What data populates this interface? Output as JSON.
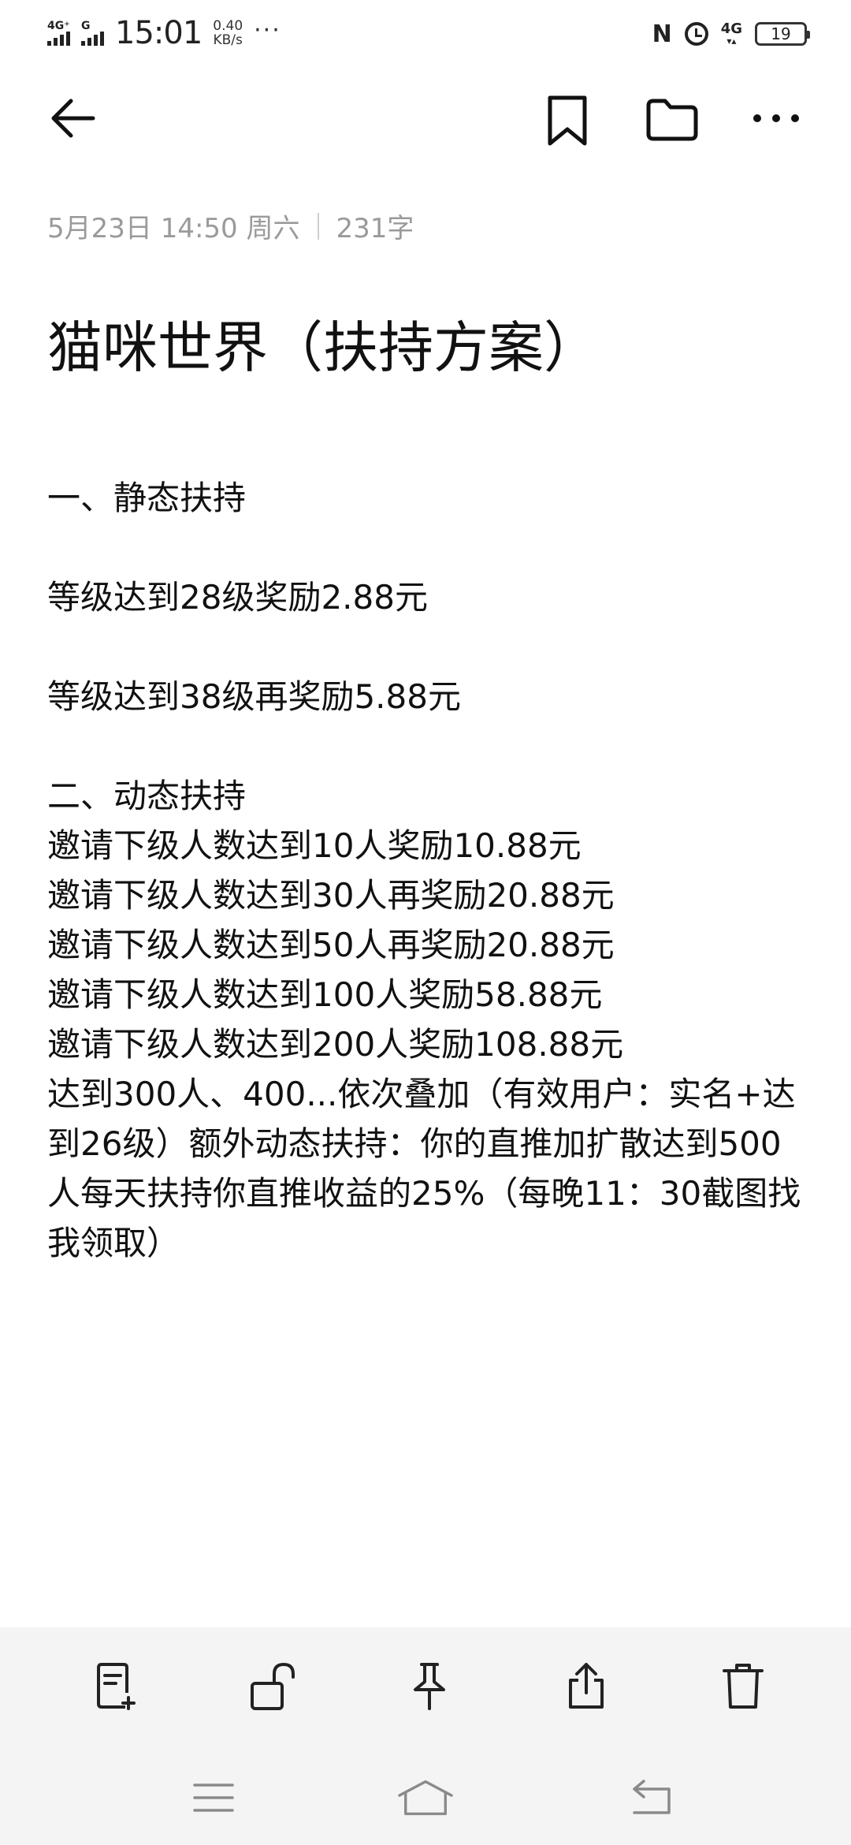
{
  "status_bar": {
    "network_1": "4G⁺",
    "network_2": "G",
    "time": "15:01",
    "speed_value": "0.40",
    "speed_unit": "KB/s",
    "more": "···",
    "network_right": "4G",
    "battery": "19"
  },
  "note": {
    "date": "5月23日 14:50 周六",
    "word_count": "231字",
    "title": "猫咪世界（扶持方案）",
    "lines": {
      "l1": "一、静态扶持",
      "l2": "等级达到28级奖励2.88元",
      "l3": "等级达到38级再奖励5.88元",
      "l4": "二、动态扶持",
      "l5": "邀请下级人数达到10人奖励10.88元",
      "l6": "邀请下级人数达到30人再奖励20.88元",
      "l7": "邀请下级人数达到50人再奖励20.88元",
      "l8": "邀请下级人数达到100人奖励58.88元",
      "l9": "邀请下级人数达到200人奖励108.88元",
      "l10": "达到300人、400...依次叠加（有效用户：实名+达到26级）额外动态扶持：你的直推加扩散达到500人每天扶持你直推收益的25%（每晚11：30截图找我领取）"
    }
  },
  "icons": {
    "back": "arrow-left-icon",
    "bookmark": "bookmark-icon",
    "folder": "folder-icon",
    "more": "more-horizontal-icon",
    "new_note": "new-note-icon",
    "unlock": "unlock-icon",
    "pin": "pin-icon",
    "share": "share-icon",
    "delete": "trash-icon",
    "menu": "menu-icon",
    "home": "home-icon",
    "return": "return-icon"
  },
  "colors": {
    "text": "#111111",
    "meta": "#9a9a9a",
    "toolbar_bg": "#f4f4f4"
  }
}
